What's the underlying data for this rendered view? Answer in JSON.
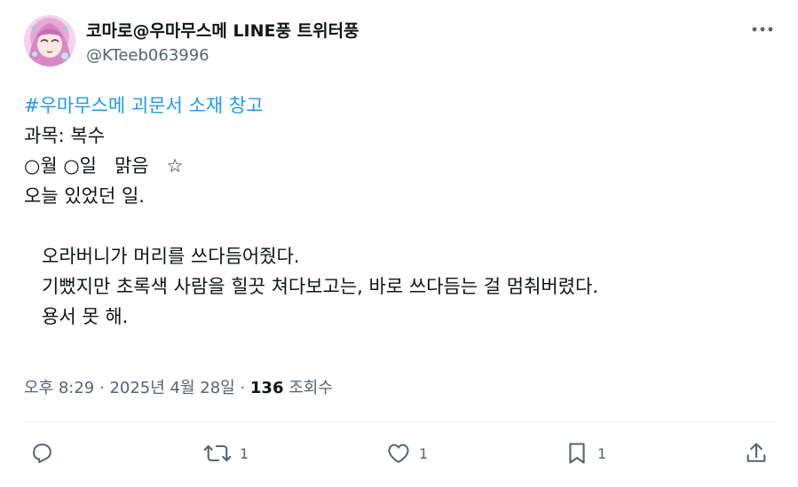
{
  "author": {
    "display_name": "코마로@우마무스메 LINE풍 트위터풍",
    "handle": "@KTeeb063996",
    "avatar": "avatar-image"
  },
  "tweet": {
    "hashtag": "#우마무스메 괴문서 소재 창고",
    "lines": [
      "과목: 복수",
      "○월 ○일   맑음   ☆",
      "오늘 있었던 일.",
      "",
      "   오라버니가 머리를 쓰다듬어줬다.",
      "   기뻤지만 초록색 사람을 힐끗 쳐다보고는, 바로 쓰다듬는 걸 멈춰버렸다.",
      "   용서 못 해."
    ]
  },
  "meta": {
    "time": "오후 8:29",
    "sep": " · ",
    "date": "2025년 4월 28일",
    "sep2": " · ",
    "views_count": "136",
    "views_label": " 조회수"
  },
  "actions": {
    "reply_icon": "reply-icon",
    "retweet_icon": "retweet-icon",
    "retweet_count": "1",
    "like_icon": "heart-icon",
    "like_count": "1",
    "bookmark_icon": "bookmark-icon",
    "bookmark_count": "1",
    "share_icon": "share-icon"
  },
  "colors": {
    "link": "#1d9bf0",
    "text": "#0f1419",
    "secondary": "#536471",
    "divider": "#eff3f4"
  }
}
